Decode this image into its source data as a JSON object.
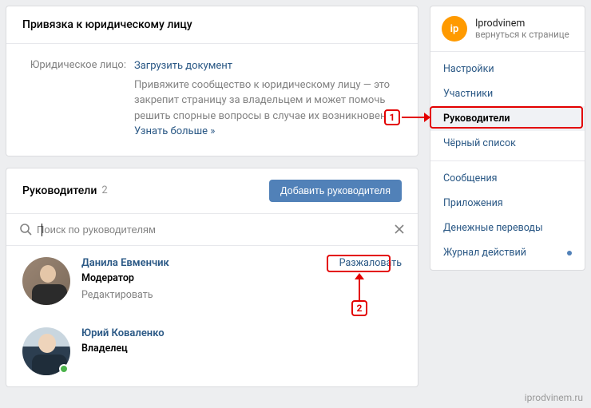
{
  "legal": {
    "header": "Привязка к юридическому лицу",
    "label": "Юридическое лицо:",
    "upload": "Загрузить документ",
    "desc": "Привяжите сообщество к юридическому лицу — это закрепит страницу за владельцем и может помочь решить спорные вопросы в случае их возникновен",
    "more": "Узнать больше »"
  },
  "managers": {
    "title": "Руководители",
    "count": "2",
    "add_btn": "Добавить руководителя",
    "search_placeholder": "Поиск по руководителям",
    "members": [
      {
        "name": "Данила Евменчик",
        "role": "Модератор",
        "edit": "Редактировать",
        "dismiss": "Разжаловать",
        "online": false
      },
      {
        "name": "Юрий Коваленко",
        "role": "Владелец",
        "edit": "",
        "dismiss": "",
        "online": true
      }
    ]
  },
  "sidebar": {
    "profile": {
      "avatar_text": "ip",
      "name": "Iprodvinem",
      "sub": "вернуться к странице"
    },
    "groups": [
      [
        "Настройки",
        "Участники",
        "Руководители",
        "Чёрный список"
      ],
      [
        "Сообщения",
        "Приложения",
        "Денежные переводы",
        "Журнал действий"
      ]
    ],
    "active": "Руководители",
    "dot_on": "Журнал действий"
  },
  "annotations": {
    "badge1": "1",
    "badge2": "2"
  },
  "watermark": "iprodvinem.ru"
}
